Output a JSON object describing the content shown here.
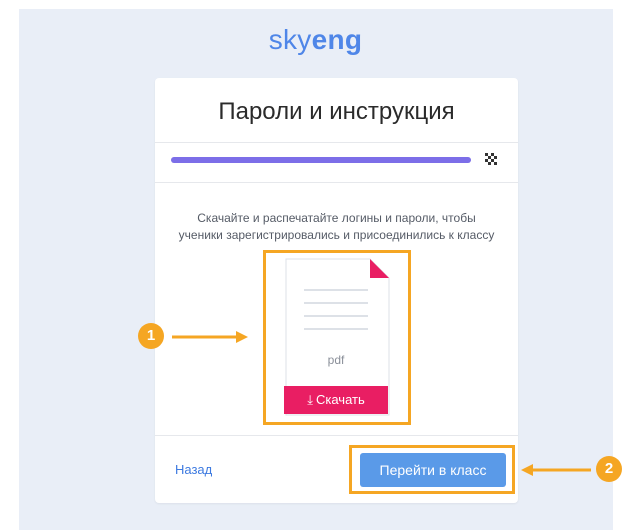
{
  "logo": {
    "light": "sky",
    "bold": "eng"
  },
  "card": {
    "title": "Пароли и инструкция",
    "progress": 1.0,
    "description_line1": "Скачайте и распечатайте логины и пароли, чтобы",
    "description_line2": "ученики зарегистрировались и присоединились к классу",
    "file": {
      "type_label": "pdf",
      "download_label": "Скачать",
      "icon": "download-icon"
    },
    "back_label": "Назад",
    "go_to_class_label": "Перейти в класс",
    "finish_icon": "checkered-flag-icon"
  },
  "annotations": {
    "marker1": "1",
    "marker2": "2"
  },
  "colors": {
    "logo": "#4f86e8",
    "progress": "#7c6ee8",
    "download": "#e91e63",
    "primary": "#5a9ae8",
    "link": "#3d7ae0",
    "annotation": "#f5a623",
    "page_bg": "#e9eef7"
  }
}
